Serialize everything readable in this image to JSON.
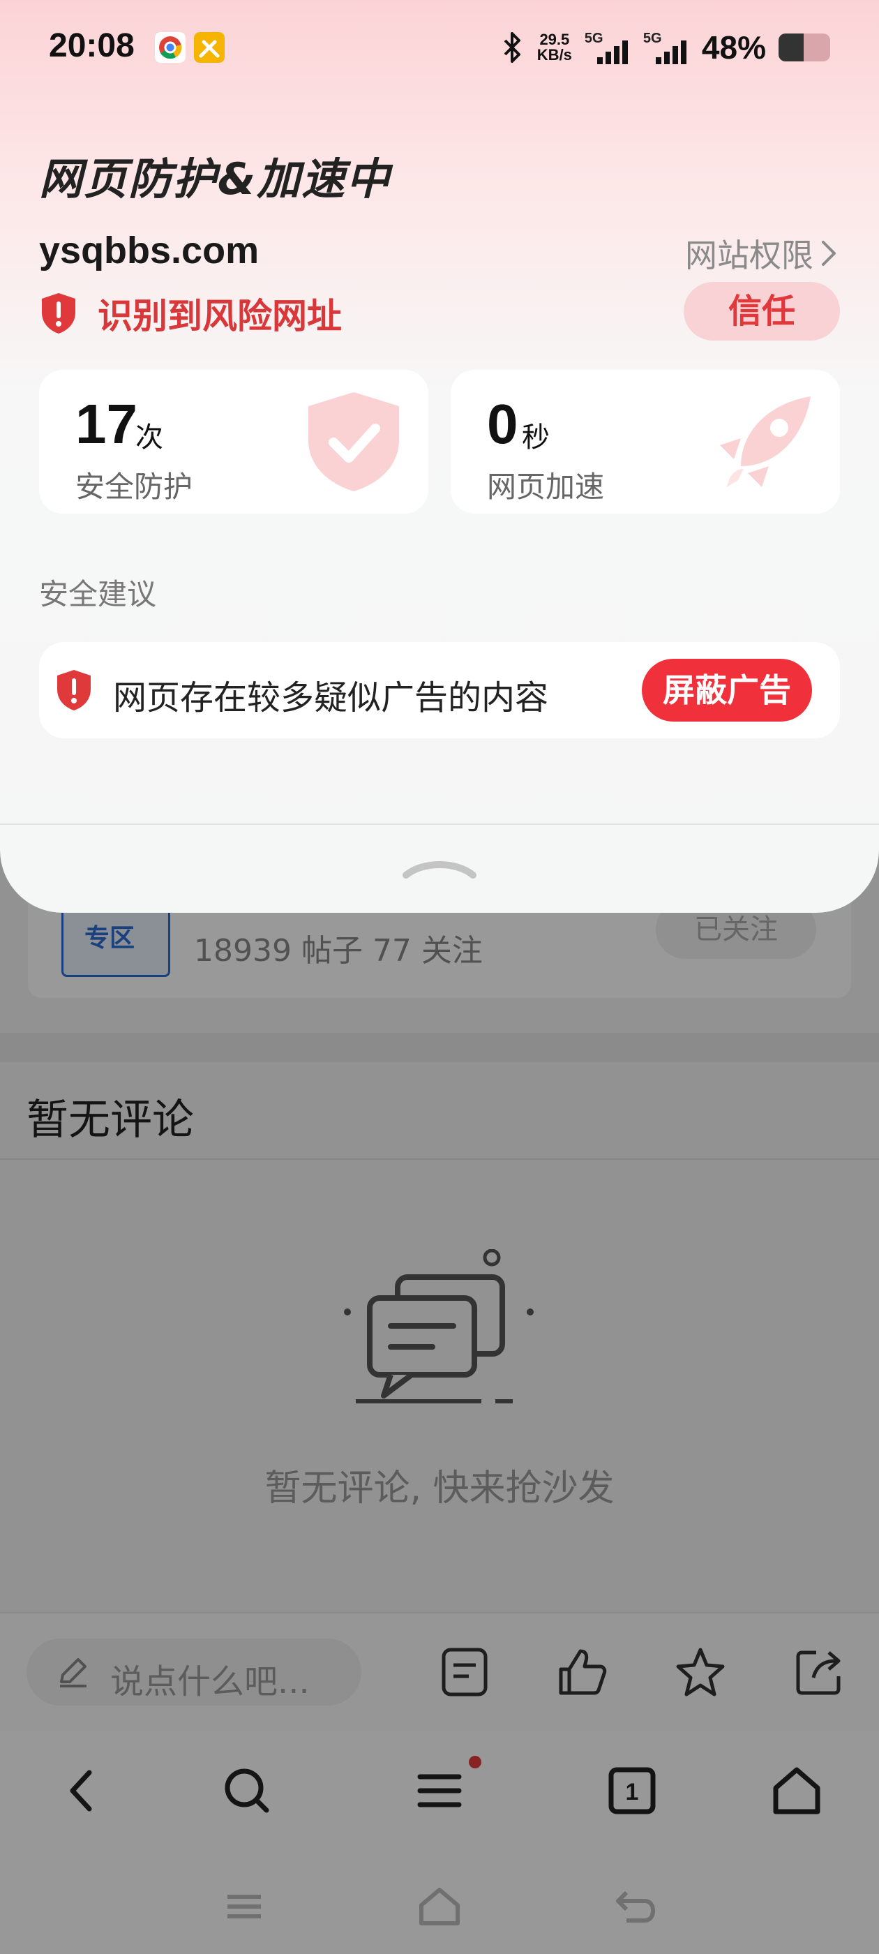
{
  "status_bar": {
    "time": "20:08",
    "net_speed_value": "29.5",
    "net_speed_unit": "KB/s",
    "sim1_label": "5G",
    "sim2_label": "5G",
    "battery_percent": "48%",
    "battery_level": 0.48,
    "icons": [
      "chrome-icon",
      "tools-app-icon",
      "bluetooth-icon",
      "signal-icon",
      "signal-icon"
    ]
  },
  "security_sheet": {
    "title": "网页防护&加速中",
    "domain": "ysqbbs.com",
    "permissions_link": "网站权限",
    "risk_text": "识别到风险网址",
    "trust_button": "信任",
    "stats": {
      "protection": {
        "value": "17",
        "unit": "次",
        "label": "安全防护"
      },
      "acceleration": {
        "value": "0",
        "unit": "秒",
        "label": "网页加速"
      }
    },
    "advice_heading": "安全建议",
    "advice_item": "网页存在较多疑似广告的内容",
    "block_ads_button": "屏蔽广告",
    "colors": {
      "danger": "#e0393c",
      "button_red": "#f0303b",
      "trust_bg": "#f8d2d4"
    }
  },
  "background_page": {
    "forum_thumb_label": "专区",
    "forum_stats": "18939 帖子   77 关注",
    "follow_button": "已关注",
    "comments_title": "暂无评论",
    "empty_state": "暂无评论, 快来抢沙发",
    "comment_placeholder": "说点什么吧...",
    "toolbar_icons": [
      "edit-icon",
      "note-icon",
      "like-icon",
      "star-icon",
      "share-icon"
    ],
    "browser_nav_icons": [
      "back-icon",
      "search-icon",
      "menu-icon",
      "tabs-icon",
      "home-icon"
    ],
    "tab_count": "1",
    "system_nav_icons": [
      "recents-icon",
      "home-icon",
      "back-icon"
    ]
  }
}
